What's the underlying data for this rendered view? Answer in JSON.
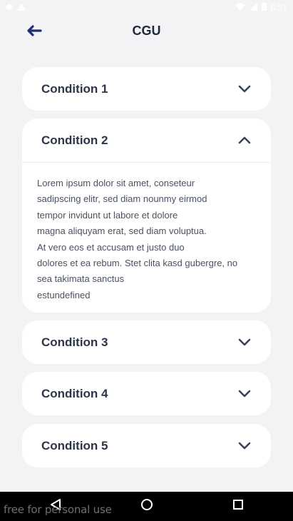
{
  "status_bar": {
    "time": "6:31",
    "left_icons": [
      "notification-dot-icon",
      "warning-icon"
    ],
    "right_icons": [
      "wifi-icon",
      "signal-icon",
      "battery-icon"
    ]
  },
  "header": {
    "title": "CGU",
    "back_icon": "arrow-back-icon"
  },
  "accordion": [
    {
      "title": "Condition 1",
      "expanded": false
    },
    {
      "title": "Condition 2",
      "expanded": true,
      "body": "Lorem ipsum dolor sit amet, conseteur\nsadipscing elitr, sed diam nounmy eirmod\ntempor invidunt ut labore et dolore\nmagna aliquyam erat, sed diam voluptua.\nAt vero eos et accusam et justo duo\ndolores et ea rebum. Stet clita kasd gubergre, no\nsea takimata sanctus\nestundefined"
    },
    {
      "title": "Condition 3",
      "expanded": false
    },
    {
      "title": "Condition 4",
      "expanded": false
    },
    {
      "title": "Condition 5",
      "expanded": false
    }
  ],
  "nav_bar": {
    "icons": [
      "back-triangle-icon",
      "home-circle-icon",
      "recents-square-icon"
    ],
    "watermark": "free for personal use"
  },
  "colors": {
    "background": "#f3f3f5",
    "card": "#ffffff",
    "title": "#202a3a",
    "back_arrow": "#1f2f73",
    "chevron": "#3a4356"
  }
}
